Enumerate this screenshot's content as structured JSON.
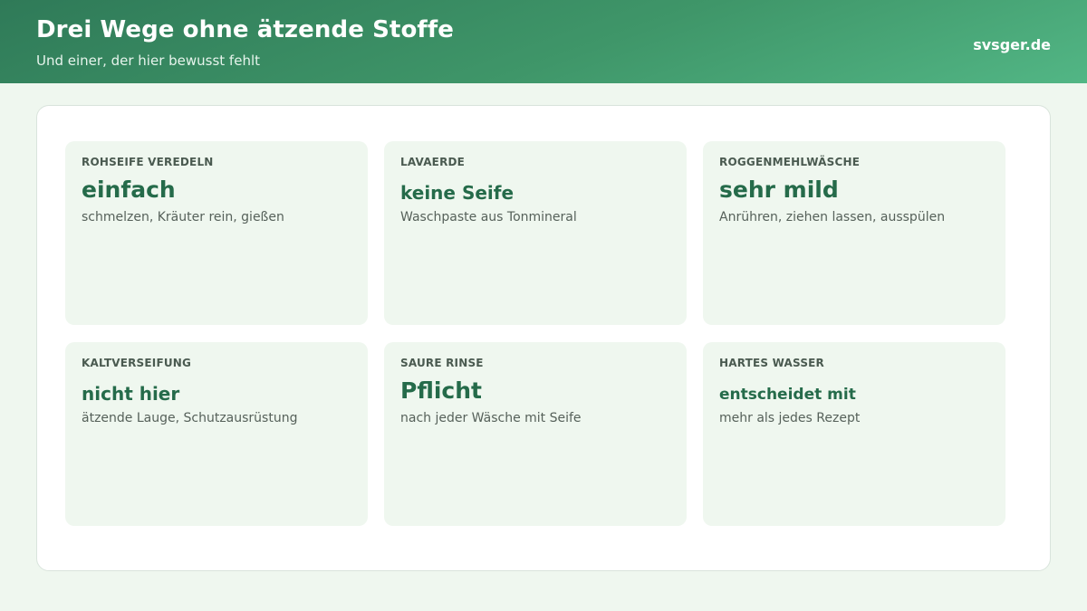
{
  "header": {
    "title": "Drei Wege ohne ätzende Stoffe",
    "subtitle": "Und einer, der hier bewusst fehlt",
    "brand": "svsger.de"
  },
  "cards": [
    {
      "label": "ROHSEIFE VEREDELN",
      "value": "einfach",
      "description": "schmelzen, Kräuter rein, gießen"
    },
    {
      "label": "LAVAERDE",
      "value": "keine Seife",
      "description": "Waschpaste aus Tonmineral"
    },
    {
      "label": "ROGGENMEHLWÄSCHE",
      "value": "sehr mild",
      "description": "Anrühren, ziehen lassen, ausspülen"
    },
    {
      "label": "KALTVERSEIFUNG",
      "value": "nicht hier",
      "description": "ätzende Lauge, Schutzausrüstung"
    },
    {
      "label": "SAURE RINSE",
      "value": "Pflicht",
      "description": "nach jeder Wäsche mit Seife"
    },
    {
      "label": "HARTES WASSER",
      "value": "entscheidet mit",
      "description": "mehr als jedes Rezept"
    }
  ]
}
